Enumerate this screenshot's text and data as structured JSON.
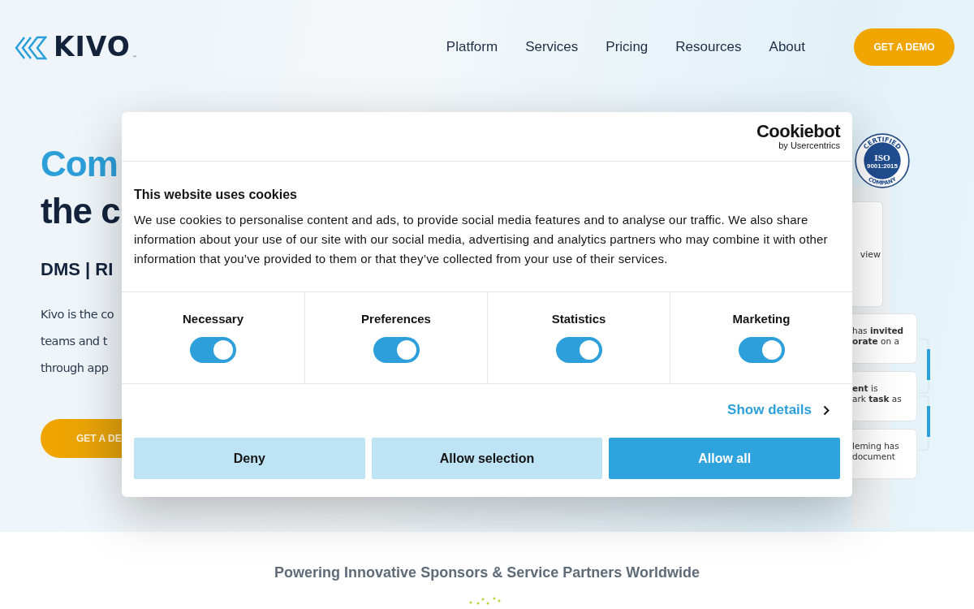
{
  "header": {
    "logo": "KIVO",
    "logo_mark": "™",
    "nav": [
      "Platform",
      "Services",
      "Pricing",
      "Resources",
      "About"
    ],
    "cta": "GET A DEMO"
  },
  "hero": {
    "headline_1": "Com",
    "headline_2": "the c",
    "subhead": "DMS | RI",
    "paragraph": [
      "Kivo is the co",
      "teams and t",
      "through app"
    ],
    "cta": "GET A DE",
    "badge": {
      "top": "CERTIFIED",
      "middle": "ISO",
      "standard": "9001:2015",
      "bottom": "COMPANY"
    },
    "preview_card": "view",
    "activity": [
      {
        "lines": [
          "has **invited**",
          "**orate** on a"
        ]
      },
      {
        "lines": [
          "**ent** is",
          "ark **task** as"
        ]
      },
      {
        "lines": [
          "leming has",
          "document"
        ]
      }
    ]
  },
  "partners": {
    "title": "Powering Innovative Sponsors & Service Partners Worldwide"
  },
  "cookie_dialog": {
    "brand": "Cookiebot",
    "brand_sub": "by Usercentrics",
    "title": "This website uses cookies",
    "text": "We use cookies to personalise content and ads, to provide social media features and to analyse our traffic. We also share information about your use of our site with our social media, advertising and analytics partners who may combine it with other information that you’ve provided to them or that they’ve collected from your use of their services.",
    "categories": [
      {
        "label": "Necessary",
        "checked": true
      },
      {
        "label": "Preferences",
        "checked": true
      },
      {
        "label": "Statistics",
        "checked": true
      },
      {
        "label": "Marketing",
        "checked": true
      }
    ],
    "details_link": "Show details",
    "buttons": [
      {
        "label": "Deny",
        "kind": "secondary"
      },
      {
        "label": "Allow selection",
        "kind": "secondary"
      },
      {
        "label": "Allow all",
        "kind": "primary"
      }
    ]
  }
}
